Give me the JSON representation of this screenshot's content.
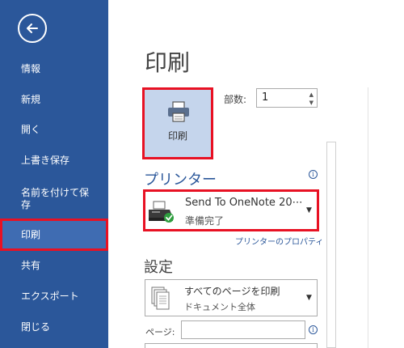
{
  "sidebar": {
    "back_icon": "arrow-left-icon",
    "items": [
      {
        "label": "情報"
      },
      {
        "label": "新規"
      },
      {
        "label": "開く"
      },
      {
        "label": "上書き保存"
      },
      {
        "label": "名前を付けて保存"
      },
      {
        "label": "印刷"
      },
      {
        "label": "共有"
      },
      {
        "label": "エクスポート"
      },
      {
        "label": "閉じる"
      }
    ],
    "colors": {
      "background": "#2b579a",
      "active": "#3f6cb2",
      "highlight": "#e81123"
    }
  },
  "main": {
    "title": "印刷",
    "print_button": {
      "label": "印刷",
      "icon": "printer-icon"
    },
    "copies": {
      "label": "部数:",
      "value": "1"
    },
    "printer_section": {
      "title": "プリンター",
      "selected_name": "Send To OneNote 20⋯",
      "status": "準備完了",
      "properties_link": "プリンターのプロパティ"
    },
    "settings_section": {
      "title": "設定",
      "print_range": {
        "main": "すべてのページを印刷",
        "sub": "ドキュメント全体"
      },
      "pages_label": "ページ:",
      "pages_value": ""
    }
  }
}
